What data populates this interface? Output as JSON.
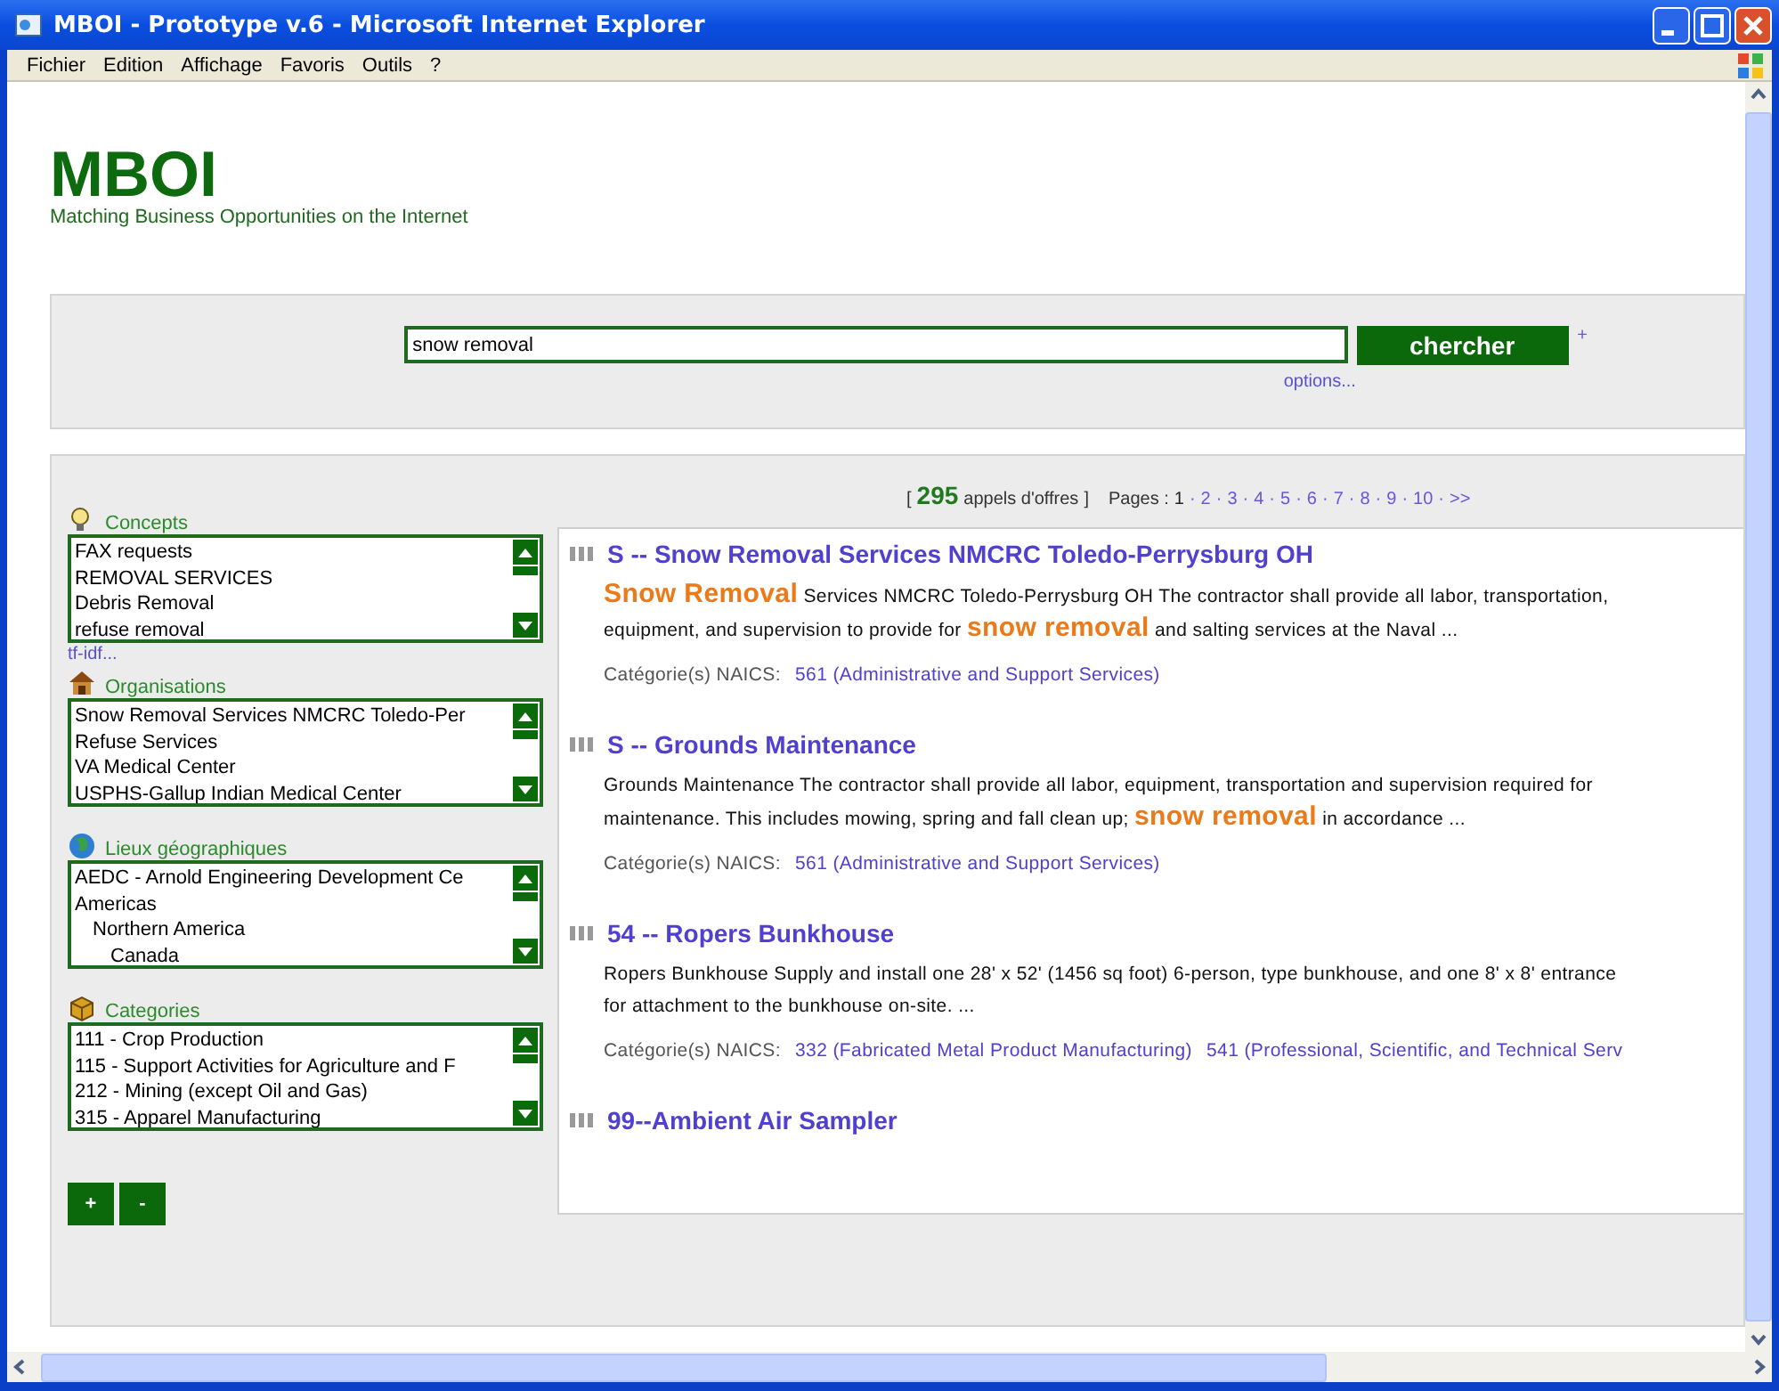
{
  "window": {
    "title": "MBOI - Prototype v.6 - Microsoft Internet Explorer"
  },
  "menu": [
    "Fichier",
    "Edition",
    "Affichage",
    "Favoris",
    "Outils",
    "?"
  ],
  "header": {
    "logo": "MBOI",
    "tagline": "Matching Business Opportunities on the Internet"
  },
  "search": {
    "value": "snow removal",
    "button": "chercher",
    "plus": "+",
    "options_link": "options..."
  },
  "facets": [
    {
      "kind": "concepts",
      "title": "Concepts",
      "items": [
        {
          "label": "FAX requests"
        },
        {
          "label": "REMOVAL SERVICES"
        },
        {
          "label": "Debris Removal"
        },
        {
          "label": "refuse removal"
        }
      ],
      "link": "tf-idf..."
    },
    {
      "kind": "organisations",
      "title": "Organisations",
      "items": [
        {
          "label": "Snow Removal Services NMCRC Toledo-Per"
        },
        {
          "label": "Refuse Services"
        },
        {
          "label": "VA Medical Center"
        },
        {
          "label": "USPHS-Gallup Indian Medical Center"
        }
      ]
    },
    {
      "kind": "places",
      "title": "Lieux géographiques",
      "items": [
        {
          "label": "AEDC - Arnold Engineering Development Ce"
        },
        {
          "label": "Americas",
          "children": [
            {
              "label": "Northern America",
              "children": [
                {
                  "label": "Canada"
                }
              ]
            }
          ]
        }
      ]
    },
    {
      "kind": "categories",
      "title": "Categories",
      "items": [
        {
          "label": "111 - Crop Production"
        },
        {
          "label": "115 - Support Activities for Agriculture and F"
        },
        {
          "label": "212 - Mining (except Oil and Gas)"
        },
        {
          "label": "315 - Apparel Manufacturing"
        }
      ]
    }
  ],
  "facet_buttons": [
    "+",
    "-"
  ],
  "summary": {
    "open": "[",
    "count": "295",
    "label": "appels d'offres",
    "close": "]",
    "pages_label": "Pages :",
    "separator": "·",
    "pages": [
      {
        "label": "1",
        "selected": true
      },
      {
        "label": "2",
        "selected": false
      },
      {
        "label": "3",
        "selected": false
      },
      {
        "label": "4",
        "selected": false
      },
      {
        "label": "5",
        "selected": false
      },
      {
        "label": "6",
        "selected": false
      },
      {
        "label": "7",
        "selected": false
      },
      {
        "label": "8",
        "selected": false
      },
      {
        "label": "9",
        "selected": false
      },
      {
        "label": "10",
        "selected": false
      },
      {
        "label": ">>",
        "selected": false
      }
    ]
  },
  "results": [
    {
      "title": "S -- Snow Removal Services NMCRC Toledo-Perrysburg OH",
      "lines": [
        "**Snow Removal** Services NMCRC Toledo-Perrysburg OH The contractor shall provide all labor, transportation,",
        "equipment, and supervision to provide for **snow removal** and salting services at the Naval ..."
      ],
      "category_label": "Catégorie(s) NAICS:",
      "categories": [
        "561 (Administrative and Support Services)"
      ]
    },
    {
      "title": "S -- Grounds Maintenance",
      "lines": [
        "Grounds Maintenance The contractor shall provide all labor, equipment, transportation and supervision required for",
        "maintenance. This includes mowing, spring and fall clean up; **snow removal** in accordance ..."
      ],
      "category_label": "Catégorie(s) NAICS:",
      "categories": [
        "561 (Administrative and Support Services)"
      ]
    },
    {
      "title": "54 -- Ropers Bunkhouse",
      "lines": [
        "Ropers Bunkhouse Supply and install one 28' x 52' (1456 sq foot) 6-person, type bunkhouse, and one 8' x 8' entrance",
        "for attachment to the bunkhouse on-site. ..."
      ],
      "category_label": "Catégorie(s) NAICS:",
      "categories": [
        "332 (Fabricated Metal Product Manufacturing)",
        "541 (Professional, Scientific, and Technical Serv"
      ]
    },
    {
      "title": "99--Ambient Air Sampler"
    }
  ]
}
